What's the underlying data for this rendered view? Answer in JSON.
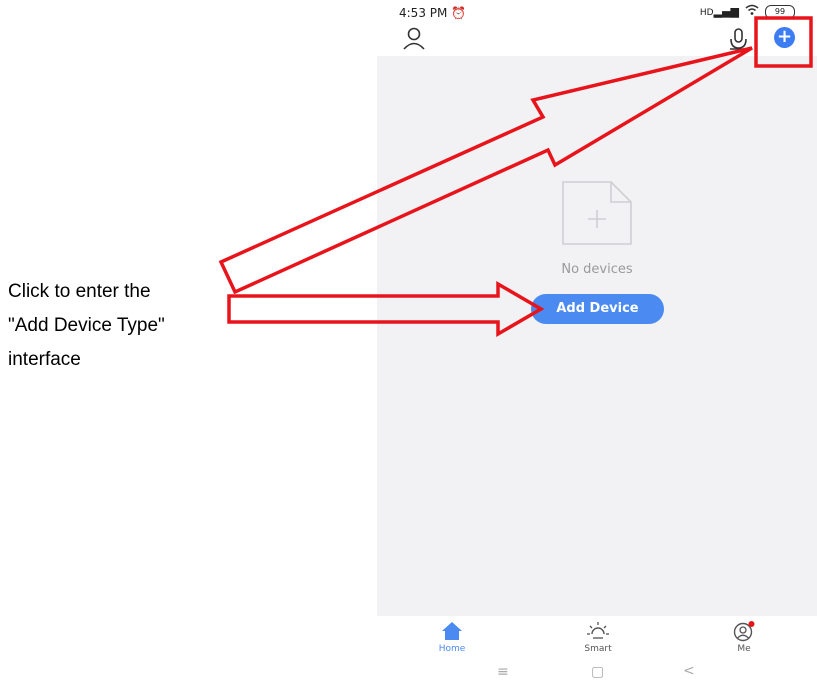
{
  "annotation": {
    "lines": [
      "Click to enter the",
      "\"Add Device Type\"",
      "interface"
    ],
    "highlight_color": "#e8141b"
  },
  "status_bar": {
    "time": "4:53 PM",
    "signal": "HD",
    "battery": "99"
  },
  "top_bar": {
    "profile_icon": "user-icon",
    "mic_icon": "microphone-icon",
    "add_icon": "plus-circle-icon",
    "add_glyph": "+"
  },
  "main": {
    "empty_icon": "empty-file-plus-icon",
    "empty_text": "No devices",
    "add_device_label": "Add Device",
    "accent_color": "#4a8af1"
  },
  "tabs": [
    {
      "label": "Home",
      "icon": "home-icon",
      "active": true
    },
    {
      "label": "Smart",
      "icon": "sun-icon",
      "active": false
    },
    {
      "label": "Me",
      "icon": "me-icon",
      "active": false
    }
  ],
  "nav": {
    "menu": "≡",
    "home": "▢",
    "back": "<"
  }
}
